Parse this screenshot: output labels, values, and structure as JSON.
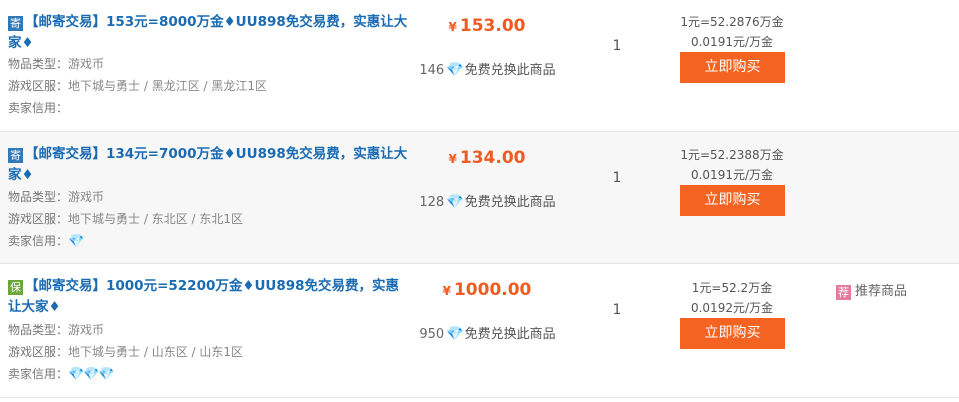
{
  "listings": [
    {
      "badge": "寄",
      "title": "【邮寄交易】153元=8000万金♦UU898免交易费，实惠让大家♦",
      "item_type_label": "物品类型：",
      "item_type": "游戏币",
      "server_label": "游戏区服：",
      "server": "地下城与勇士 / 黑龙江区 / 黑龙江1区",
      "credit_label": "卖家信用：",
      "credit": "",
      "currency": "¥",
      "price": "153.00",
      "exchange_count": "146",
      "exchange_label": "免费兑换此商品",
      "quantity": "1",
      "rate1": "1元=52.2876万金",
      "rate2": "0.0191元/万金",
      "buy_label": "立即购买",
      "recommend": ""
    },
    {
      "badge": "寄",
      "title": "【邮寄交易】134元=7000万金♦UU898免交易费，实惠让大家♦",
      "item_type_label": "物品类型：",
      "item_type": "游戏币",
      "server_label": "游戏区服：",
      "server": "地下城与勇士 / 东北区 / 东北1区",
      "credit_label": "卖家信用：",
      "credit": "💎",
      "currency": "¥",
      "price": "134.00",
      "exchange_count": "128",
      "exchange_label": "免费兑换此商品",
      "quantity": "1",
      "rate1": "1元=52.2388万金",
      "rate2": "0.0191元/万金",
      "buy_label": "立即购买",
      "recommend": ""
    },
    {
      "badge": "保",
      "title": "【邮寄交易】1000元=52200万金♦UU898免交易费，实惠让大家♦",
      "item_type_label": "物品类型：",
      "item_type": "游戏币",
      "server_label": "游戏区服：",
      "server": "地下城与勇士 / 山东区 / 山东1区",
      "credit_label": "卖家信用：",
      "credit": "💎💎💎",
      "currency": "¥",
      "price": "1000.00",
      "exchange_count": "950",
      "exchange_label": "免费兑换此商品",
      "quantity": "1",
      "rate1": "1元=52.2万金",
      "rate2": "0.0192元/万金",
      "buy_label": "立即购买",
      "recommend_tag": "荐",
      "recommend": "推荐商品"
    }
  ],
  "icons": {
    "diamond": "diamond-icon",
    "badge_ji": "mail-badge-icon",
    "badge_bao": "guarantee-badge-icon",
    "tag": "recommend-tag-icon"
  },
  "colors": {
    "title": "#1a6bb3",
    "price": "#f05a23",
    "buy": "#f56323",
    "diamond": "#27b6d6",
    "recommend_tag": "#e8799a"
  }
}
